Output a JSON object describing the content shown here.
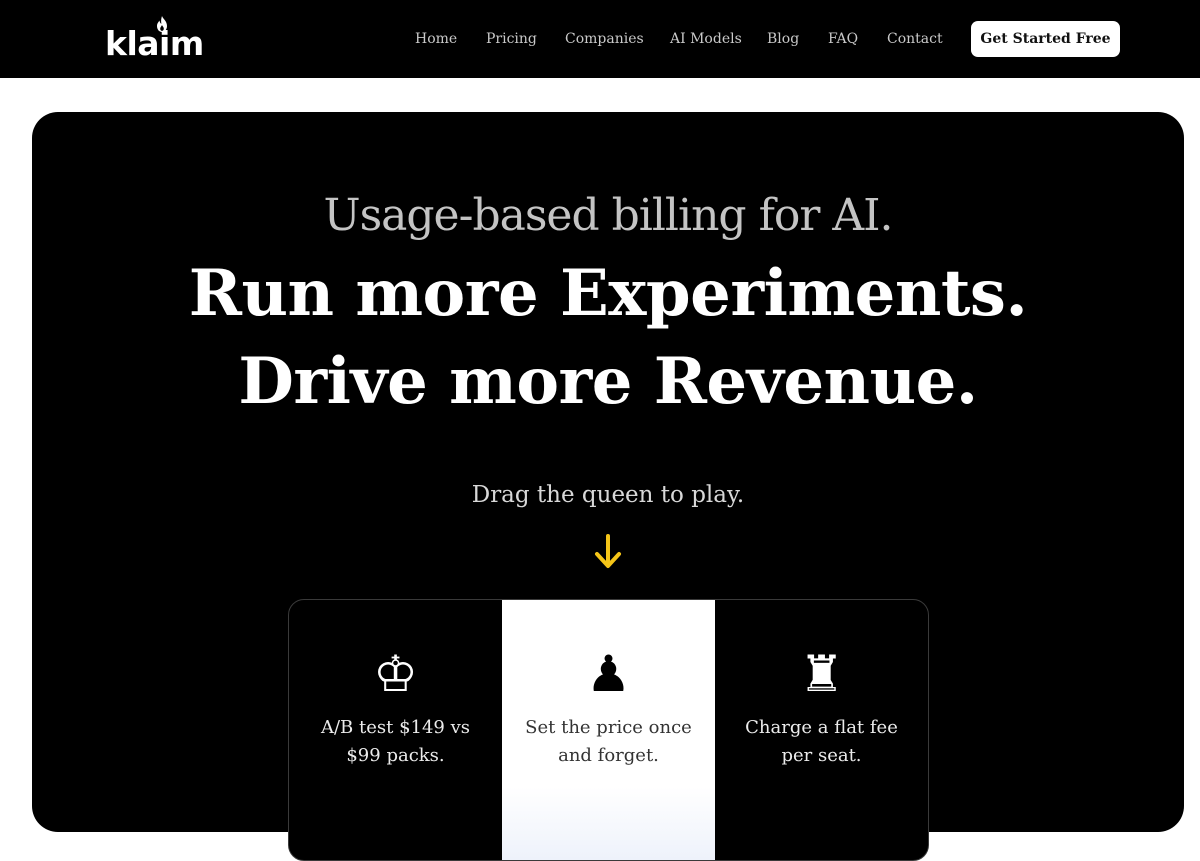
{
  "header": {
    "logo_text": "klaim",
    "nav": [
      {
        "label": "Home"
      },
      {
        "label": "Pricing"
      },
      {
        "label": "Companies"
      },
      {
        "label": "AI Models"
      },
      {
        "label": "Blog"
      },
      {
        "label": "FAQ"
      },
      {
        "label": "Contact"
      }
    ],
    "cta_label": "Get Started Free"
  },
  "hero": {
    "eyebrow": "Usage-based billing for AI.",
    "headline_line1": "Run more Experiments.",
    "headline_line2": "Drive more Revenue.",
    "hint": "Drag the queen to play.",
    "arrow_icon": "arrow-down-icon",
    "arrow_color": "#f5c518"
  },
  "cards": [
    {
      "icon": "chess-king-icon",
      "glyph": "♔",
      "text": "A/B test $149 vs $99 packs."
    },
    {
      "icon": "chess-pawn-icon",
      "glyph": "♟",
      "text": "Set the price once and forget."
    },
    {
      "icon": "chess-rook-icon",
      "glyph": "♜",
      "text": "Charge a flat fee per seat."
    }
  ],
  "colors": {
    "background": "#000000",
    "accent": "#f5c518",
    "cta_bg": "#ffffff"
  }
}
